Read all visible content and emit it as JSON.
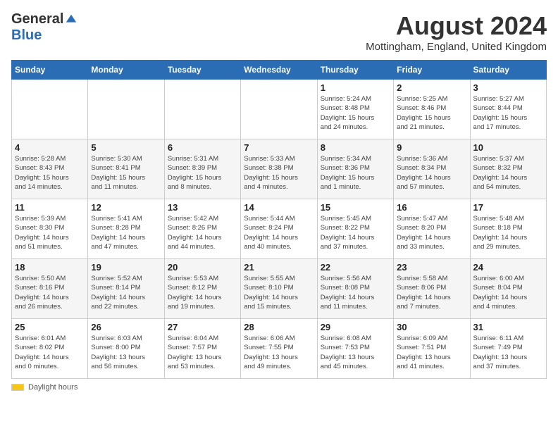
{
  "header": {
    "logo_general": "General",
    "logo_blue": "Blue",
    "month_year": "August 2024",
    "location": "Mottingham, England, United Kingdom"
  },
  "days_of_week": [
    "Sunday",
    "Monday",
    "Tuesday",
    "Wednesday",
    "Thursday",
    "Friday",
    "Saturday"
  ],
  "weeks": [
    [
      {
        "day": "",
        "info": ""
      },
      {
        "day": "",
        "info": ""
      },
      {
        "day": "",
        "info": ""
      },
      {
        "day": "",
        "info": ""
      },
      {
        "day": "1",
        "info": "Sunrise: 5:24 AM\nSunset: 8:48 PM\nDaylight: 15 hours\nand 24 minutes."
      },
      {
        "day": "2",
        "info": "Sunrise: 5:25 AM\nSunset: 8:46 PM\nDaylight: 15 hours\nand 21 minutes."
      },
      {
        "day": "3",
        "info": "Sunrise: 5:27 AM\nSunset: 8:44 PM\nDaylight: 15 hours\nand 17 minutes."
      }
    ],
    [
      {
        "day": "4",
        "info": "Sunrise: 5:28 AM\nSunset: 8:43 PM\nDaylight: 15 hours\nand 14 minutes."
      },
      {
        "day": "5",
        "info": "Sunrise: 5:30 AM\nSunset: 8:41 PM\nDaylight: 15 hours\nand 11 minutes."
      },
      {
        "day": "6",
        "info": "Sunrise: 5:31 AM\nSunset: 8:39 PM\nDaylight: 15 hours\nand 8 minutes."
      },
      {
        "day": "7",
        "info": "Sunrise: 5:33 AM\nSunset: 8:38 PM\nDaylight: 15 hours\nand 4 minutes."
      },
      {
        "day": "8",
        "info": "Sunrise: 5:34 AM\nSunset: 8:36 PM\nDaylight: 15 hours\nand 1 minute."
      },
      {
        "day": "9",
        "info": "Sunrise: 5:36 AM\nSunset: 8:34 PM\nDaylight: 14 hours\nand 57 minutes."
      },
      {
        "day": "10",
        "info": "Sunrise: 5:37 AM\nSunset: 8:32 PM\nDaylight: 14 hours\nand 54 minutes."
      }
    ],
    [
      {
        "day": "11",
        "info": "Sunrise: 5:39 AM\nSunset: 8:30 PM\nDaylight: 14 hours\nand 51 minutes."
      },
      {
        "day": "12",
        "info": "Sunrise: 5:41 AM\nSunset: 8:28 PM\nDaylight: 14 hours\nand 47 minutes."
      },
      {
        "day": "13",
        "info": "Sunrise: 5:42 AM\nSunset: 8:26 PM\nDaylight: 14 hours\nand 44 minutes."
      },
      {
        "day": "14",
        "info": "Sunrise: 5:44 AM\nSunset: 8:24 PM\nDaylight: 14 hours\nand 40 minutes."
      },
      {
        "day": "15",
        "info": "Sunrise: 5:45 AM\nSunset: 8:22 PM\nDaylight: 14 hours\nand 37 minutes."
      },
      {
        "day": "16",
        "info": "Sunrise: 5:47 AM\nSunset: 8:20 PM\nDaylight: 14 hours\nand 33 minutes."
      },
      {
        "day": "17",
        "info": "Sunrise: 5:48 AM\nSunset: 8:18 PM\nDaylight: 14 hours\nand 29 minutes."
      }
    ],
    [
      {
        "day": "18",
        "info": "Sunrise: 5:50 AM\nSunset: 8:16 PM\nDaylight: 14 hours\nand 26 minutes."
      },
      {
        "day": "19",
        "info": "Sunrise: 5:52 AM\nSunset: 8:14 PM\nDaylight: 14 hours\nand 22 minutes."
      },
      {
        "day": "20",
        "info": "Sunrise: 5:53 AM\nSunset: 8:12 PM\nDaylight: 14 hours\nand 19 minutes."
      },
      {
        "day": "21",
        "info": "Sunrise: 5:55 AM\nSunset: 8:10 PM\nDaylight: 14 hours\nand 15 minutes."
      },
      {
        "day": "22",
        "info": "Sunrise: 5:56 AM\nSunset: 8:08 PM\nDaylight: 14 hours\nand 11 minutes."
      },
      {
        "day": "23",
        "info": "Sunrise: 5:58 AM\nSunset: 8:06 PM\nDaylight: 14 hours\nand 7 minutes."
      },
      {
        "day": "24",
        "info": "Sunrise: 6:00 AM\nSunset: 8:04 PM\nDaylight: 14 hours\nand 4 minutes."
      }
    ],
    [
      {
        "day": "25",
        "info": "Sunrise: 6:01 AM\nSunset: 8:02 PM\nDaylight: 14 hours\nand 0 minutes."
      },
      {
        "day": "26",
        "info": "Sunrise: 6:03 AM\nSunset: 8:00 PM\nDaylight: 13 hours\nand 56 minutes."
      },
      {
        "day": "27",
        "info": "Sunrise: 6:04 AM\nSunset: 7:57 PM\nDaylight: 13 hours\nand 53 minutes."
      },
      {
        "day": "28",
        "info": "Sunrise: 6:06 AM\nSunset: 7:55 PM\nDaylight: 13 hours\nand 49 minutes."
      },
      {
        "day": "29",
        "info": "Sunrise: 6:08 AM\nSunset: 7:53 PM\nDaylight: 13 hours\nand 45 minutes."
      },
      {
        "day": "30",
        "info": "Sunrise: 6:09 AM\nSunset: 7:51 PM\nDaylight: 13 hours\nand 41 minutes."
      },
      {
        "day": "31",
        "info": "Sunrise: 6:11 AM\nSunset: 7:49 PM\nDaylight: 13 hours\nand 37 minutes."
      }
    ]
  ],
  "footer": {
    "daylight_label": "Daylight hours"
  }
}
